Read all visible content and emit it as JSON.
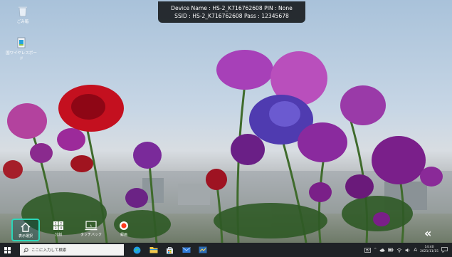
{
  "banner": {
    "line1": "Device Name : HS-2_K716762608   PIN : None",
    "line2": "SSID : HS-2_K716762608   Pass : 12345678"
  },
  "desktop_icons": [
    {
      "label": "ごみ箱",
      "icon": "recycle-bin-icon"
    },
    {
      "label": "国ワイヤレスボード",
      "icon": "wireless-board-app-icon"
    }
  ],
  "toolbar": {
    "items": [
      {
        "label": "表示選択",
        "icon": "home-icon",
        "active": true
      },
      {
        "label": "分割",
        "icon": "split-screen-icon",
        "active": false
      },
      {
        "label": "タッチバック",
        "icon": "touch-back-icon",
        "active": false
      },
      {
        "label": "録画",
        "icon": "record-icon",
        "active": false
      }
    ],
    "collapse_label": "«"
  },
  "taskbar": {
    "search_placeholder": "ここに入力して検索",
    "pinned": [
      "edge-icon",
      "file-explorer-icon",
      "store-icon",
      "mail-icon",
      "app-icon"
    ],
    "tray": {
      "ime": "A",
      "time": "14:40",
      "date": "2021/11/15"
    }
  },
  "colors": {
    "accent": "#2bd6b9",
    "record": "#ff3b1f",
    "taskbar": "#1f2226"
  }
}
